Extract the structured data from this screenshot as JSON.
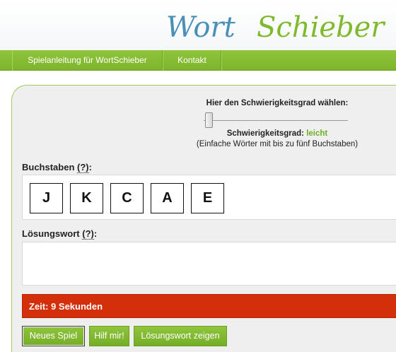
{
  "colors": {
    "brand_green": "#7eb52c",
    "logo_blue": "#4a8fb8",
    "logo_green": "#7fba2e",
    "timer_red": "#d22f0a",
    "difficulty_value_color": "#6fae23"
  },
  "header": {
    "logo": {
      "part1": "Wort",
      "part2": "Schieber"
    }
  },
  "nav": {
    "items": [
      {
        "label": "Spielanleitung für WortSchieber"
      },
      {
        "label": "Kontakt"
      }
    ]
  },
  "difficulty": {
    "heading": "Hier den Schwierigkeitsgrad wählen:",
    "slider_level": 0,
    "status_label": "Schwierigkeitsgrad:",
    "status_value": "leicht",
    "note": "(Einfache Wörter mit bis zu fünf Buchstaben)"
  },
  "letters": {
    "label": "Buchstaben",
    "help": "(?)",
    "colon": ":",
    "tiles": [
      "J",
      "K",
      "C",
      "A",
      "E"
    ]
  },
  "solution": {
    "label": "Lösungswort",
    "help": "(?)",
    "colon": ":",
    "tiles": []
  },
  "timer": {
    "text": "Zeit: 9 Sekunden"
  },
  "buttons": {
    "new_game": "Neues Spiel",
    "help": "Hilf mir!",
    "show_solution": "Lösungswort zeigen"
  }
}
